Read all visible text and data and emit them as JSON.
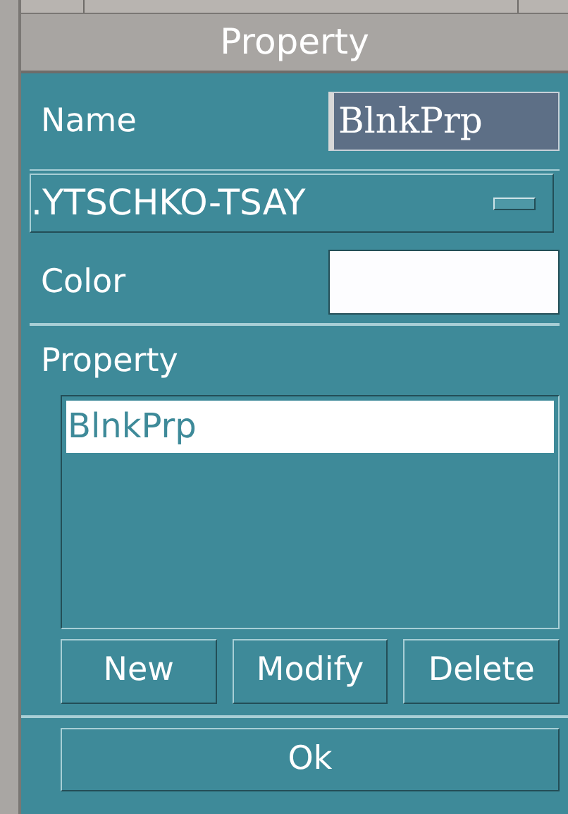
{
  "window": {
    "title": "Property"
  },
  "name_field": {
    "label": "Name",
    "value": "BlnkPrp"
  },
  "dropdown": {
    "value": ".YTSCHKO-TSAY"
  },
  "color_field": {
    "label": "Color"
  },
  "property_list": {
    "label": "Property",
    "items": [
      {
        "label": "BlnkPrp",
        "selected": true
      }
    ]
  },
  "buttons": [
    "New",
    "Modify",
    "Delete"
  ],
  "ok_button": "Ok"
}
